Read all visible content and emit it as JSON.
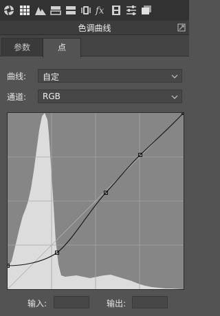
{
  "toolbar": {
    "icons": [
      "aperture-icon",
      "grid-icon",
      "mountains-icon",
      "split-toning-icon",
      "detail-bars-icon",
      "lens-icon",
      "fx-icon",
      "filmstrip-icon",
      "sliders-icon",
      "presets-icon"
    ]
  },
  "panel": {
    "title": "色调曲线"
  },
  "tabs": [
    {
      "label": "参数",
      "active": false
    },
    {
      "label": "点",
      "active": true
    }
  ],
  "curve_select": {
    "label": "曲线:",
    "value": "自定"
  },
  "channel_select": {
    "label": "通道:",
    "value": "RGB"
  },
  "io": {
    "input_label": "输入:",
    "output_label": "输出:",
    "input_value": "",
    "output_value": ""
  },
  "colors": {
    "background": "#535353",
    "graph_bg": "#868686",
    "histogram": "#dcdcdc",
    "curve": "#000000"
  }
}
